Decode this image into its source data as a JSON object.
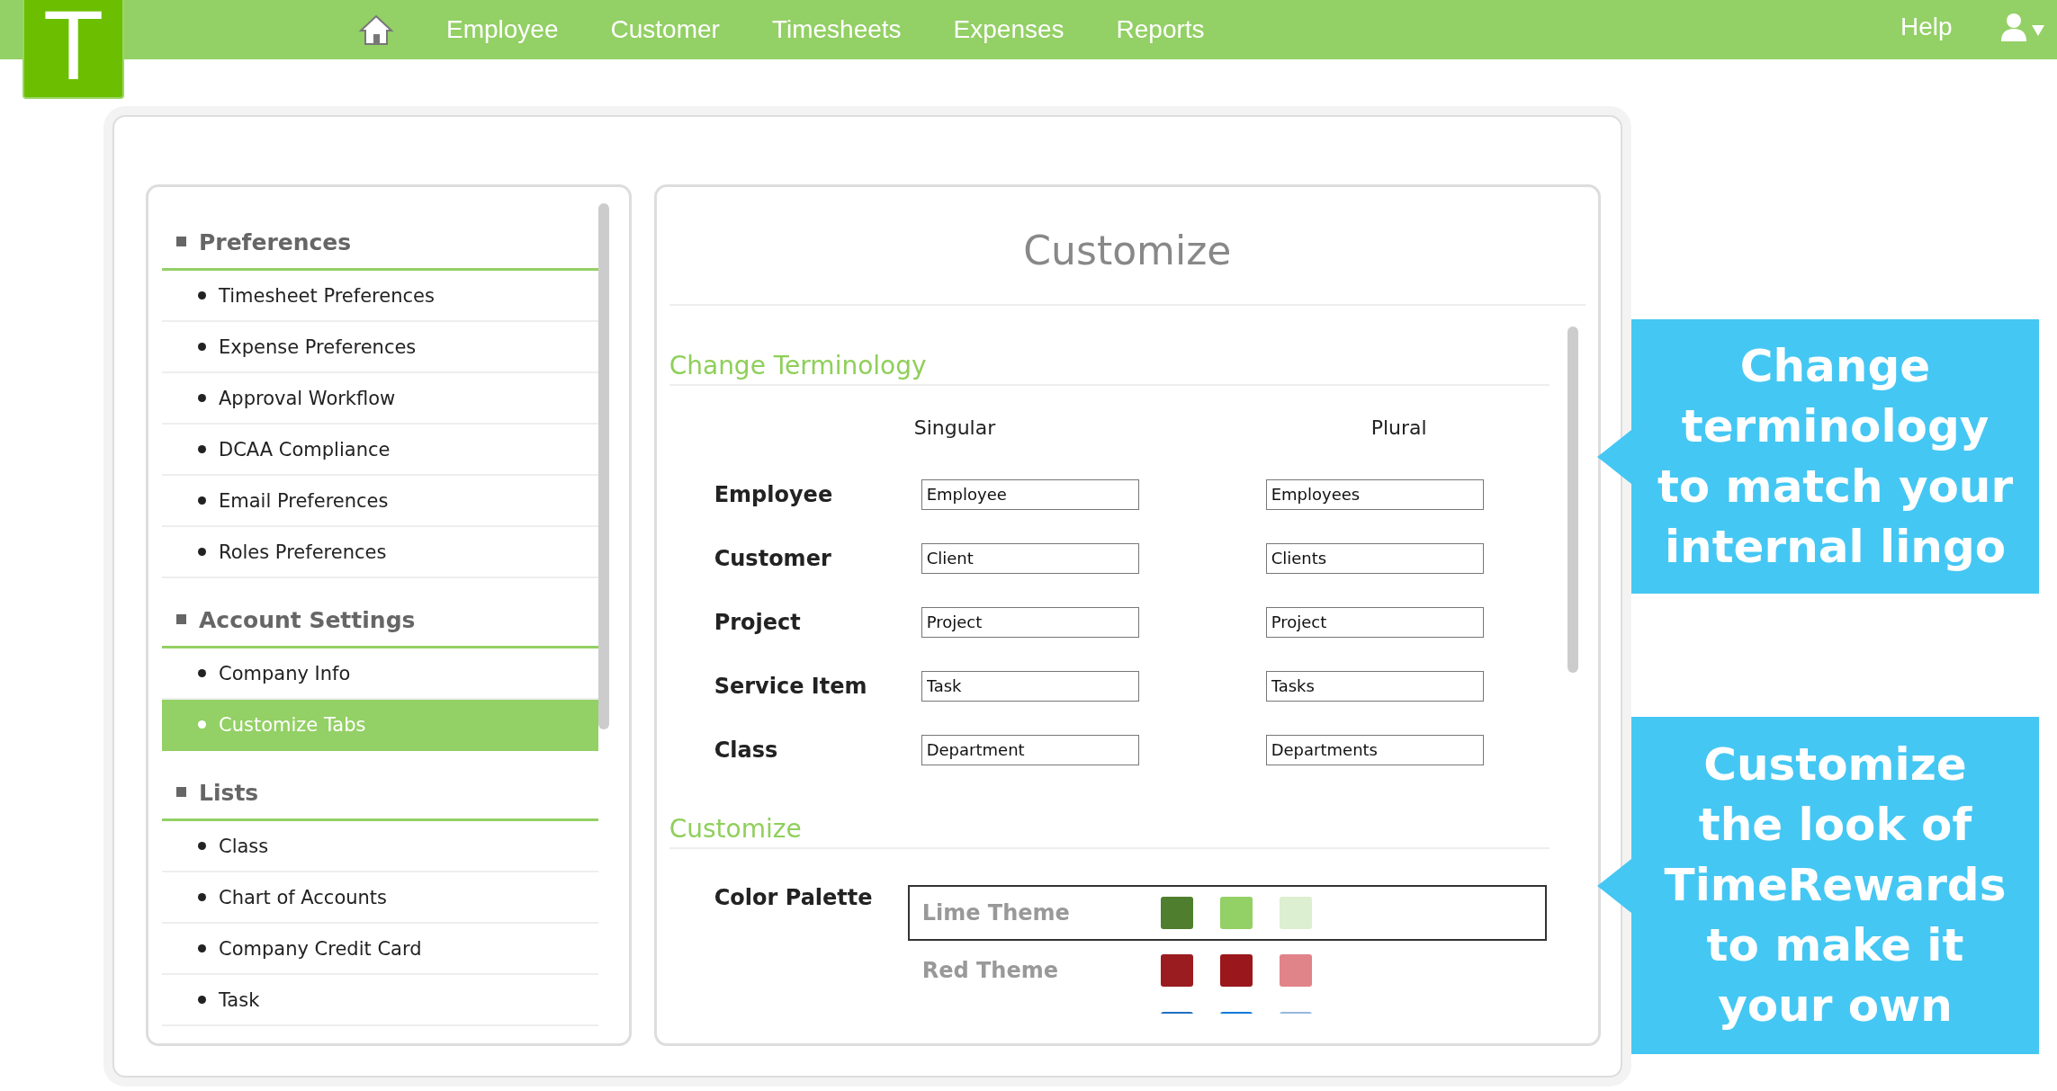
{
  "logo": {
    "letter": "T"
  },
  "nav": {
    "items": [
      "Employee",
      "Customer",
      "Timesheets",
      "Expenses",
      "Reports"
    ],
    "help": "Help"
  },
  "sidebar": {
    "sections": [
      {
        "title": "Preferences",
        "items": [
          {
            "label": "Timesheet Preferences",
            "selected": false
          },
          {
            "label": "Expense Preferences",
            "selected": false
          },
          {
            "label": "Approval Workflow",
            "selected": false
          },
          {
            "label": "DCAA Compliance",
            "selected": false
          },
          {
            "label": "Email Preferences",
            "selected": false
          },
          {
            "label": "Roles Preferences",
            "selected": false
          }
        ]
      },
      {
        "title": "Account Settings",
        "items": [
          {
            "label": "Company Info",
            "selected": false
          },
          {
            "label": "Customize Tabs",
            "selected": true
          }
        ]
      },
      {
        "title": "Lists",
        "items": [
          {
            "label": "Class",
            "selected": false
          },
          {
            "label": "Chart of Accounts",
            "selected": false
          },
          {
            "label": "Company Credit Card",
            "selected": false
          },
          {
            "label": "Task",
            "selected": false
          }
        ]
      }
    ]
  },
  "content": {
    "title": "Customize",
    "terminology": {
      "heading": "Change Terminology",
      "columns": [
        "Singular",
        "Plural"
      ],
      "rows": [
        {
          "label": "Employee",
          "singular": "Employee",
          "plural": "Employees"
        },
        {
          "label": "Customer",
          "singular": "Client",
          "plural": "Clients"
        },
        {
          "label": "Project",
          "singular": "Project",
          "plural": "Project"
        },
        {
          "label": "Service Item",
          "singular": "Task",
          "plural": "Tasks"
        },
        {
          "label": "Class",
          "singular": "Department",
          "plural": "Departments"
        }
      ]
    },
    "customize": {
      "heading": "Customize",
      "palette_label": "Color Palette",
      "themes": [
        {
          "name": "Lime Theme",
          "selected": true,
          "swatches": [
            {
              "color": "#4f7f2e"
            },
            {
              "color": "#93d065"
            },
            {
              "color": "#dcefd0"
            }
          ]
        },
        {
          "name": "Red Theme",
          "selected": false,
          "swatches": [
            {
              "color": "#9b1c20"
            },
            {
              "color": "#9a171c"
            },
            {
              "color": "#e0848a"
            }
          ]
        },
        {
          "selected": false,
          "swatches": [
            {
              "color": "#1f6fc0"
            },
            {
              "color": "#0a7ad8"
            },
            {
              "color": "#96b8de"
            }
          ]
        }
      ]
    }
  },
  "callouts": [
    {
      "lines": [
        "Change",
        "terminology",
        "to match your",
        "internal lingo"
      ]
    },
    {
      "lines": [
        "Customize",
        "the look of",
        "TimeRewards",
        "to make it",
        "your own"
      ]
    }
  ]
}
